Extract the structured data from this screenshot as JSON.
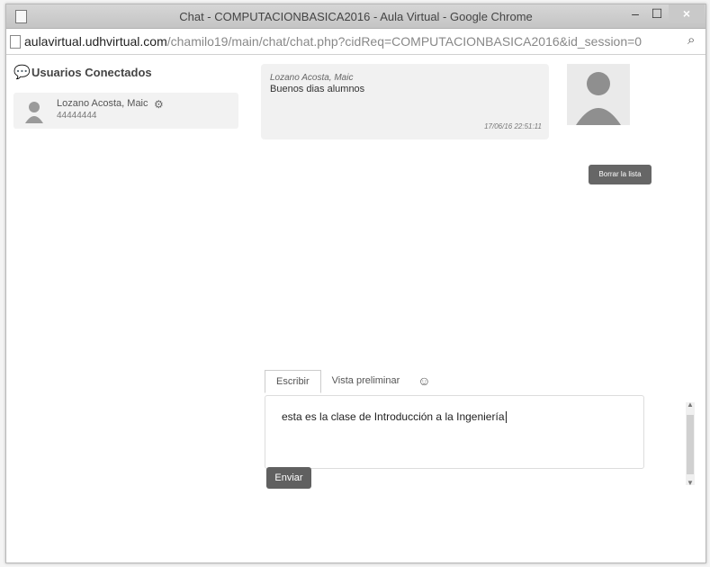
{
  "window": {
    "title": "Chat - COMPUTACIONBASICA2016 - Aula Virtual - Google Chrome",
    "minimize": "–",
    "maximize": "☐",
    "close": "×"
  },
  "browser": {
    "url_host": "aulavirtual.udhvirtual.com",
    "url_path": "/chamilo19/main/chat/chat.php?cidReq=COMPUTACIONBASICA2016&id_session=0",
    "zoom_icon": "magnifier-icon"
  },
  "users_panel": {
    "header": "Usuarios Conectados",
    "users": [
      {
        "name": "Lozano Acosta, Maic",
        "code": "44444444"
      }
    ]
  },
  "messages": [
    {
      "author": "Lozano Acosta, Maic",
      "text": "Buenos dias alumnos",
      "time": "17/06/16 22:51:11"
    }
  ],
  "actions": {
    "clear": "Borrar la lista"
  },
  "composer": {
    "tabs": [
      "Escribir",
      "Vista preliminar"
    ],
    "emoji_icon": "smiley-icon",
    "value": "esta es la clase de Introducción a la Ingeniería",
    "send": "Enviar"
  }
}
